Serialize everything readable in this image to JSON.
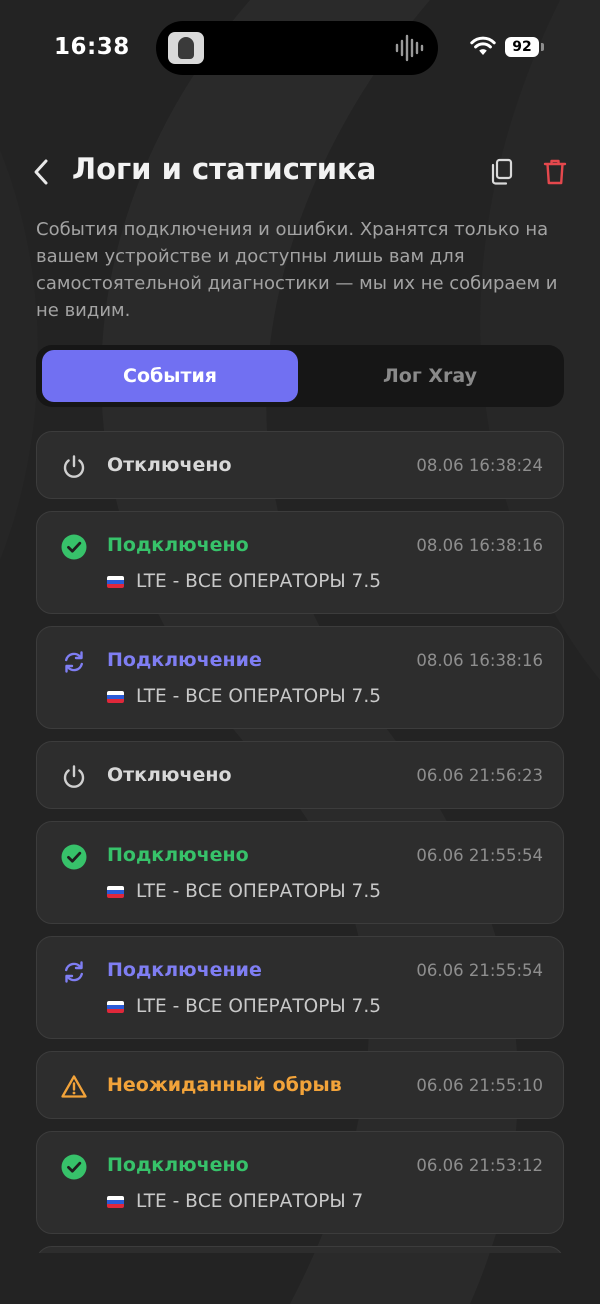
{
  "status_bar": {
    "time": "16:38",
    "battery": "92"
  },
  "header": {
    "title": "Логи и статистика"
  },
  "description": "События подключения и ошибки. Хранятся только на вашем устройстве и доступны лишь вам для самостоятельной диагностики — мы их не собираем и не видим.",
  "tabs": [
    {
      "label": "События",
      "active": true
    },
    {
      "label": "Лог Xray",
      "active": false
    }
  ],
  "colors": {
    "accent": "#7170f2",
    "connected": "#37c26a",
    "connecting": "#7f7ef3",
    "warning": "#f2a33a",
    "delete": "#e5484d"
  },
  "logs": [
    {
      "type": "disconnected",
      "icon": "power-icon",
      "status": "Отключено",
      "time": "08.06 16:38:24"
    },
    {
      "type": "connected",
      "icon": "check-circle-icon",
      "status": "Подключено",
      "time": "08.06 16:38:16",
      "server": "LTE - ВСЕ ОПЕРАТОРЫ 7.5"
    },
    {
      "type": "connecting",
      "icon": "refresh-icon",
      "status": "Подключение",
      "time": "08.06 16:38:16",
      "server": "LTE - ВСЕ ОПЕРАТОРЫ 7.5"
    },
    {
      "type": "disconnected",
      "icon": "power-icon",
      "status": "Отключено",
      "time": "06.06 21:56:23"
    },
    {
      "type": "connected",
      "icon": "check-circle-icon",
      "status": "Подключено",
      "time": "06.06 21:55:54",
      "server": "LTE - ВСЕ ОПЕРАТОРЫ 7.5"
    },
    {
      "type": "connecting",
      "icon": "refresh-icon",
      "status": "Подключение",
      "time": "06.06 21:55:54",
      "server": "LTE - ВСЕ ОПЕРАТОРЫ 7.5"
    },
    {
      "type": "warning",
      "icon": "warning-icon",
      "status": "Неожиданный обрыв",
      "time": "06.06 21:55:10"
    },
    {
      "type": "connected",
      "icon": "check-circle-icon",
      "status": "Подключено",
      "time": "06.06 21:53:12",
      "server": "LTE - ВСЕ ОПЕРАТОРЫ 7"
    }
  ]
}
